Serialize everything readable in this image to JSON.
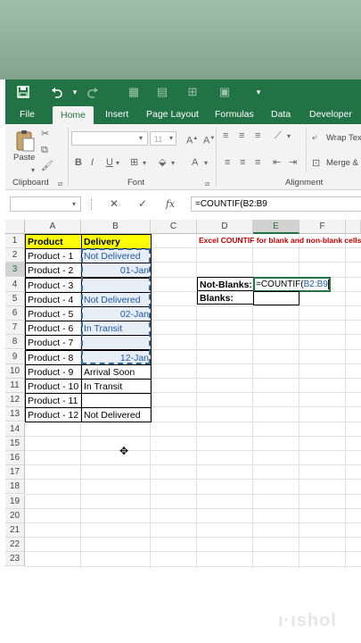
{
  "qat": {
    "icons": [
      "save-icon",
      "undo-icon",
      "redo-icon"
    ]
  },
  "tabs": [
    "File",
    "Home",
    "Insert",
    "Page Layout",
    "Formulas",
    "Data",
    "Developer"
  ],
  "ribbon": {
    "paste_label": "Paste",
    "clipboard_label": "Clipboard",
    "font_label": "Font",
    "alignment_label": "Alignment",
    "font_size": "11",
    "wrap_text": "Wrap Tex",
    "merge": "Merge &",
    "bold": "B",
    "italic": "I",
    "underline": "U"
  },
  "formula_bar": {
    "fx": "fx",
    "value": "=COUNTIF(B2:B9"
  },
  "columns": [
    "A",
    "B",
    "C",
    "D",
    "E",
    "F"
  ],
  "rows": [
    "1",
    "2",
    "3",
    "4",
    "5",
    "6",
    "7",
    "8",
    "9",
    "10",
    "11",
    "12",
    "13",
    "14",
    "15",
    "16",
    "17",
    "18",
    "19",
    "20",
    "21",
    "22",
    "23"
  ],
  "sheet": {
    "A": [
      "Product",
      "Product - 1",
      "Product - 2",
      "Product - 3",
      "Product - 4",
      "Product - 5",
      "Product - 6",
      "Product - 7",
      "Product - 8",
      "Product - 9",
      "Product - 10",
      "Product - 11",
      "Product - 12"
    ],
    "B": [
      "Delivery",
      "Not Delivered",
      "01-Jan",
      "",
      "Not Delivered",
      "02-Jan",
      "In Transit",
      "",
      "12-Jan",
      "Arrival Soon",
      "In Transit",
      "",
      "Not Delivered"
    ],
    "title_note": "Excel COUNTIF for blank and non-blank cells",
    "d3": "Not-Blanks:",
    "d4": "Blanks:",
    "e3_fn": "=COUNTIF(",
    "e3_ref": "B2:B9"
  },
  "colors": {
    "excel_green": "#217346",
    "header_yellow": "#ffff00",
    "note_red": "#c00000",
    "ref_blue": "#1f5aa6"
  }
}
